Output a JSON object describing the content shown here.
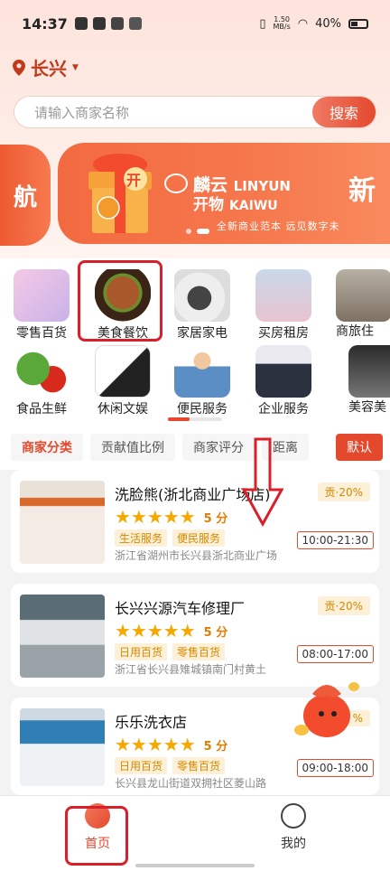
{
  "status_bar": {
    "time": "14:37",
    "net_speed": "1.50",
    "net_unit": "MB/s",
    "battery": "40%"
  },
  "location": {
    "city": "长兴"
  },
  "search": {
    "placeholder": "请输入商家名称",
    "button": "搜索"
  },
  "banner": {
    "left_text": "航",
    "gift_label": "开",
    "brand_cn": "麟云",
    "brand_en": "LINYUN",
    "brand_cn2": "开物",
    "brand_en2": "KAIWU",
    "slogan": "全新商业范本   远见数字未",
    "big_text": "新"
  },
  "categories": [
    {
      "label": "零售百货",
      "icon": "retail-icon"
    },
    {
      "label": "美食餐饮",
      "icon": "burger-icon"
    },
    {
      "label": "家居家电",
      "icon": "washer-icon"
    },
    {
      "label": "买房租房",
      "icon": "buildings-icon"
    },
    {
      "label": "商旅住",
      "icon": "hotel-icon"
    },
    {
      "label": "食品生鲜",
      "icon": "vegetables-icon"
    },
    {
      "label": "休闲文娱",
      "icon": "cards-icon"
    },
    {
      "label": "便民服务",
      "icon": "worker-icon"
    },
    {
      "label": "企业服务",
      "icon": "business-icon"
    },
    {
      "label": "美容美",
      "icon": "beauty-icon"
    }
  ],
  "filters": {
    "merchant_category": "商家分类",
    "contribution": "贡献值比例",
    "rating": "商家评分",
    "distance": "距离",
    "default": "默认"
  },
  "merchants": [
    {
      "name": "洗脸熊(浙北商业广场店)",
      "score": "5",
      "score_unit": "分",
      "tag1": "生活服务",
      "tag2": "便民服务",
      "address": "浙江省湖州市长兴县浙北商业广场",
      "contribution": "贡·20%",
      "hours": "10:00-21:30"
    },
    {
      "name": "长兴兴源汽车修理厂",
      "score": "5",
      "score_unit": "分",
      "tag1": "日用百货",
      "tag2": "零售百货",
      "address": "浙江省长兴县雉城镇南门村黄土",
      "contribution": "贡·20%",
      "hours": "08:00-17:00"
    },
    {
      "name": "乐乐洗衣店",
      "score": "5",
      "score_unit": "分",
      "tag1": "日用百货",
      "tag2": "零售百货",
      "address": "长兴县龙山街道双拥社区菱山路",
      "contribution": "%",
      "hours": "09:00-18:00"
    }
  ],
  "tabbar": {
    "home": "首页",
    "me": "我的"
  },
  "colors": {
    "accent": "#e4492e",
    "annotation": "#d9202a",
    "star": "#f4a800"
  }
}
